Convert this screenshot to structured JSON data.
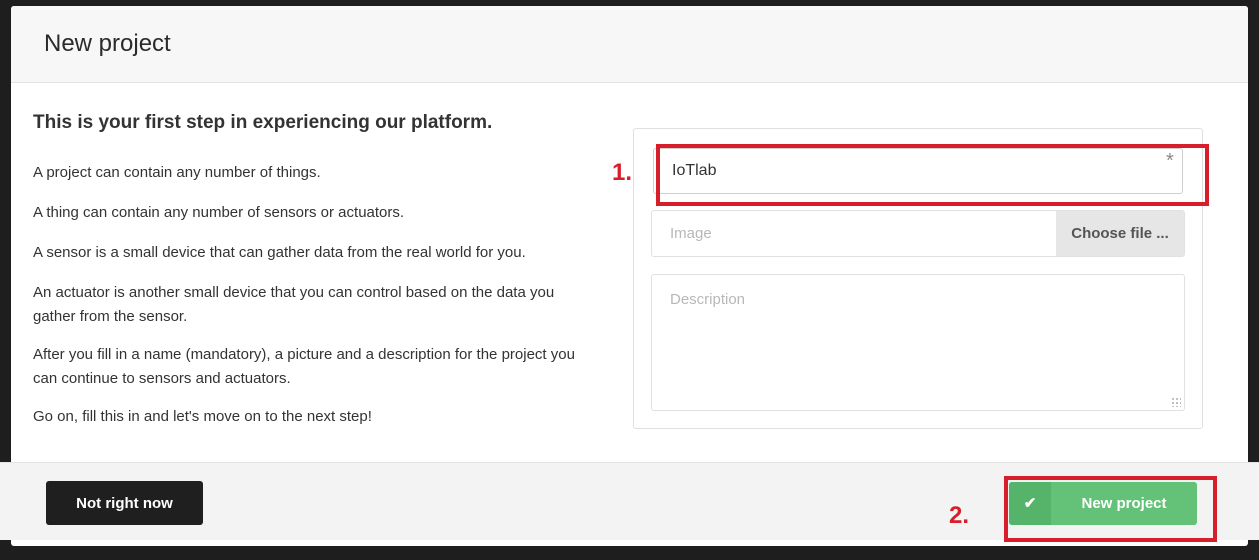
{
  "modal": {
    "title": "New project"
  },
  "intro": {
    "heading": "This is your first step in experiencing our platform.",
    "paragraphs": [
      "A project can contain any number of things.",
      "A thing can contain any number of sensors or actuators.",
      "A sensor is a small device that can gather data from the real world for you.",
      "An actuator is another small device that you can control based on the data you gather from the sensor.",
      "After you fill in a name (mandatory), a picture and a description for the project you can continue to sensors and actuators.",
      "Go on, fill this in and let's move on to the next step!"
    ]
  },
  "form": {
    "name_value": "IoTlab",
    "required_mark": "*",
    "image_placeholder": "Image",
    "choose_file_label": "Choose file ...",
    "description_placeholder": "Description"
  },
  "annotations": {
    "step1": "1.",
    "step2": "2.",
    "color": "#d61f2a"
  },
  "footer": {
    "cancel_label": "Not right now",
    "submit_label": "New project",
    "submit_icon": "check-icon"
  },
  "colors": {
    "primary_green": "#63c277",
    "dark_button": "#1f1f1f",
    "annotation_red": "#d61f2a"
  }
}
